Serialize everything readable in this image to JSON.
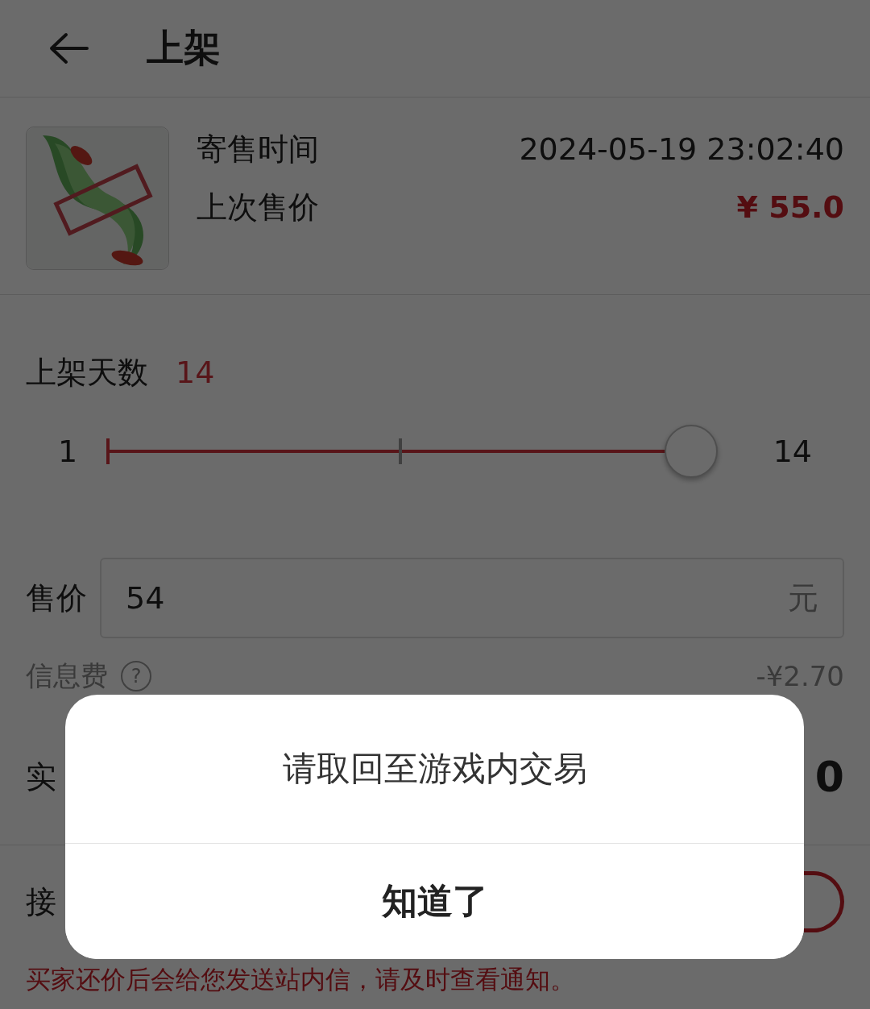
{
  "header": {
    "title": "上架"
  },
  "item": {
    "rows": [
      {
        "label": "寄售时间",
        "value": "2024-05-19 23:02:40",
        "kind": "plain"
      },
      {
        "label": "上次售价",
        "value": "¥ 55.0",
        "kind": "price"
      }
    ]
  },
  "days": {
    "label": "上架天数",
    "value": "14",
    "slider": {
      "min": "1",
      "max": "14",
      "level": 1
    }
  },
  "price": {
    "label": "售价",
    "value": "54",
    "unit": "元"
  },
  "fee": {
    "label": "信息费",
    "help": "?",
    "value": "-¥2.70"
  },
  "actual": {
    "label": "实",
    "value": "0"
  },
  "accept": {
    "label": "接",
    "toggle": {
      "on": true
    },
    "note": "买家还价后会给您发送站内信，请及时查看通知。"
  },
  "dialog": {
    "message": "请取回至游戏内交易",
    "button": "知道了"
  }
}
